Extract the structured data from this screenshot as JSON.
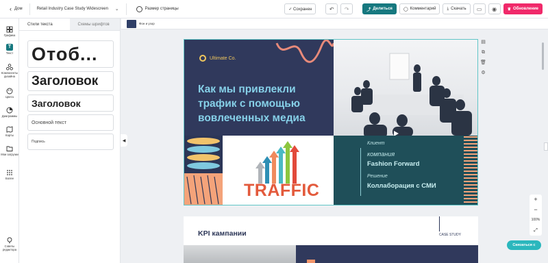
{
  "topbar": {
    "back_label": "Дом",
    "doc_title": "Retail Industry Case Study Widescreen",
    "resize_label": "Размер страницы",
    "save_label": "✓ Сохранен",
    "share_label": "Делиться",
    "comment_label": "Комментарий",
    "download_label": "Скачать",
    "upgrade_label": "Обновление"
  },
  "rail": {
    "items": [
      {
        "label": "Графика",
        "icon": "graphics-icon"
      },
      {
        "label": "Текст",
        "icon": "text-icon"
      },
      {
        "label": "Компоненты дизайна",
        "icon": "components-icon"
      },
      {
        "label": "Цвета",
        "icon": "palette-icon"
      },
      {
        "label": "Диаграммы",
        "icon": "chart-icon"
      },
      {
        "label": "Карты",
        "icon": "map-icon"
      },
      {
        "label": "Мои загрузки",
        "icon": "folder-icon"
      },
      {
        "label": "Более",
        "icon": "grid-icon"
      },
      {
        "label": "Советы редактора",
        "icon": "bulb-icon"
      }
    ]
  },
  "panel": {
    "tab_styles": "Стили текста",
    "tab_fonts": "Схемы шрифтов",
    "styles": [
      "Отоб...",
      "Заголовок",
      "Заголовок",
      "Основной текст",
      "Подпись"
    ]
  },
  "canvas": {
    "background_label": "Фон и узор"
  },
  "slide1": {
    "brand": "Ultimate Co.",
    "title": "Как мы привлекли трафик с помощью вовлеченных медиа",
    "traffic_word": "TRAFFIC",
    "client_label": "Клиент",
    "company_label": "компания",
    "company_name": "Fashion Forward",
    "solution_label": "Решение",
    "solution_value": "Коллаборация с СМИ"
  },
  "slide2": {
    "title": "KPI кампании",
    "case_label": "CASE STUDY"
  },
  "zoom": {
    "plus": "+",
    "level": "100%",
    "minus": "−"
  },
  "chat_label": "Связаться с",
  "colors": {
    "teal": "#16787f",
    "pink": "#f0296a",
    "navy": "#30395c",
    "slide_teal": "#1f4f59"
  }
}
